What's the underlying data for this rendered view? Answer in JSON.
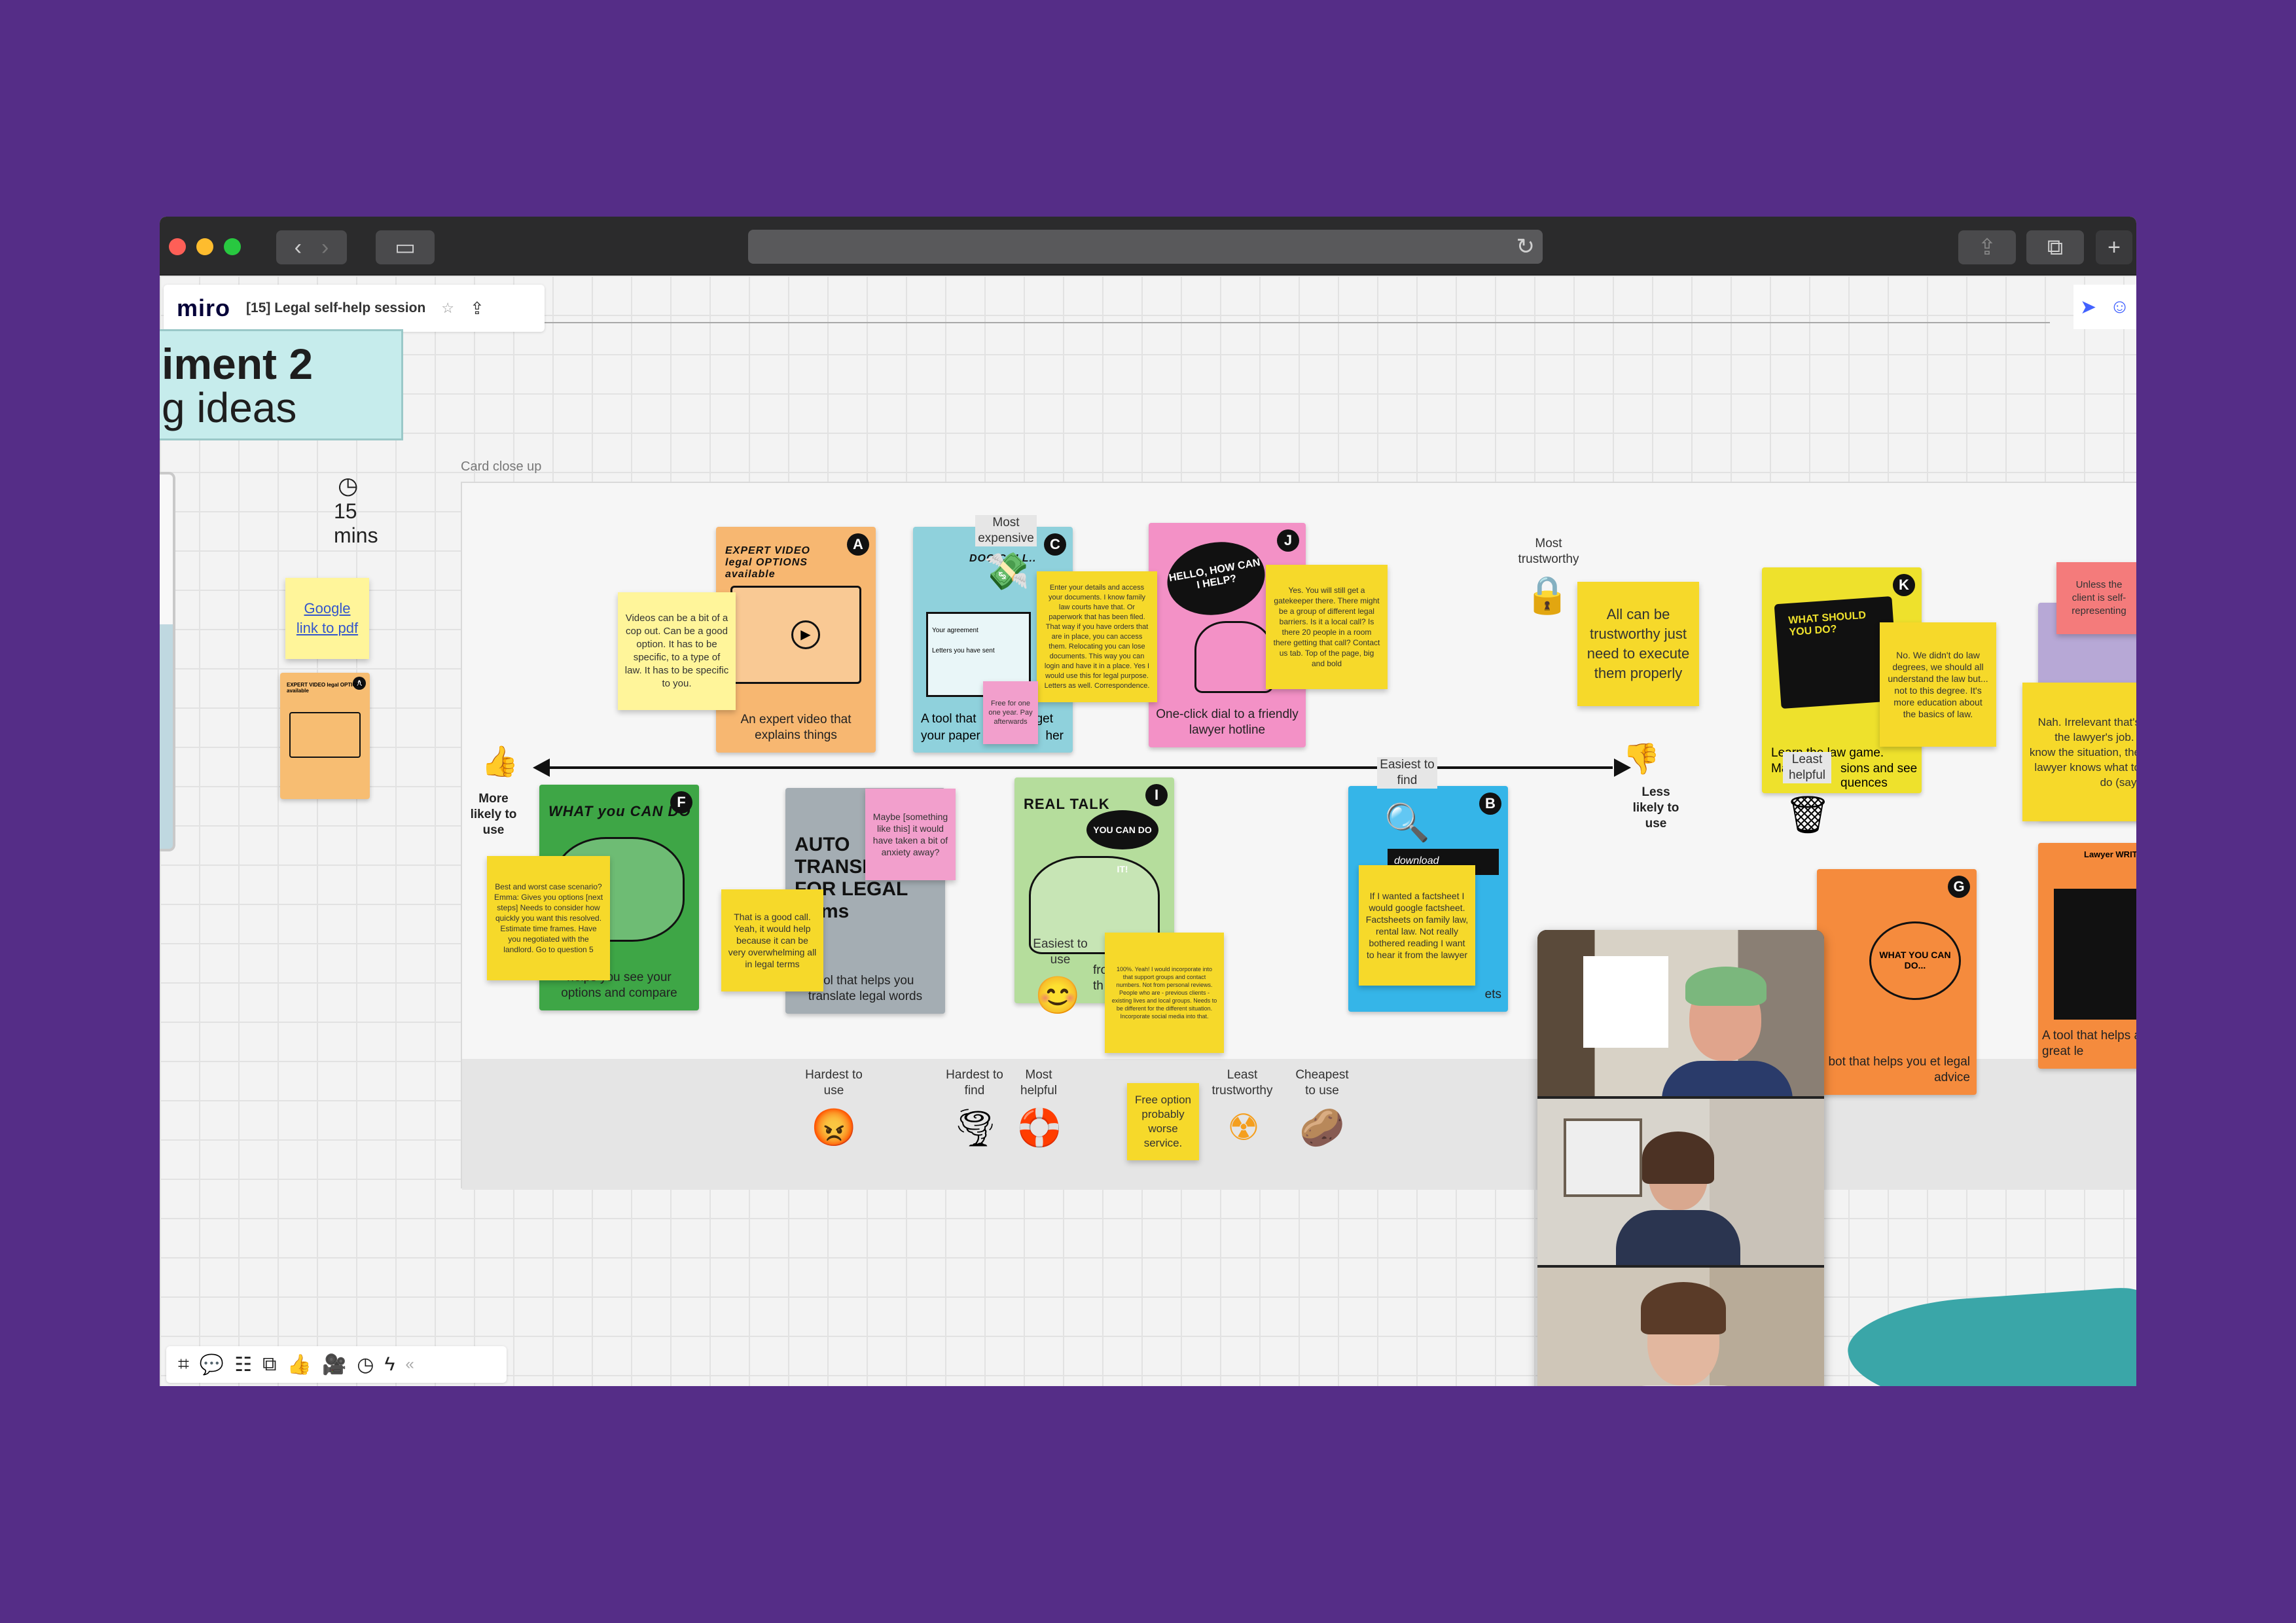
{
  "browser": {
    "toolbar_icons": [
      "back-icon",
      "forward-icon",
      "sidebar-icon",
      "share-icon",
      "tabs-icon",
      "new-tab-icon"
    ]
  },
  "app": {
    "logo": "miro",
    "board_title": "[15] Legal self-help session",
    "star": "☆",
    "upload": "⇪"
  },
  "title_card": {
    "line1": "iment 2",
    "line2": "g ideas"
  },
  "timer": {
    "value": "15",
    "unit": "mins"
  },
  "link_note": "Google link to pdf",
  "frame": {
    "label": "Card close up"
  },
  "cards": {
    "A": {
      "letter": "A",
      "heading": "EXPERT VIDEO legal OPTIONS available",
      "caption": "An expert video that explains things"
    },
    "C": {
      "letter": "C",
      "heading": "DOC COLL..",
      "caption_left": "A tool that",
      "caption_mid": "your paper",
      "caption_right1": "get",
      "caption_right2": "her",
      "field1": "Your agreement",
      "field2": "Letters you have sent"
    },
    "J": {
      "letter": "J",
      "heading": "HELLO, HOW CAN I HELP?",
      "caption": "One-click dial to a friendly lawyer hotline"
    },
    "K": {
      "letter": "K",
      "heading": "WHAT SHOULD YOU DO?",
      "caption_a": "Learn the law game.",
      "caption_b": "Make",
      "caption_c": "sions and see",
      "caption_d": "quences"
    },
    "F": {
      "letter": "F",
      "heading": "WHAT you CAN DO",
      "caption": "helps you see your options and compare"
    },
    "AUTO": {
      "heading": "AUTO TRANSLATOR FOR LEGAL forms",
      "caption": "ool that helps you translate legal words"
    },
    "I": {
      "letter": "I",
      "heading": "REAL TALK",
      "bubble": "YOU CAN DO IT!",
      "caption": "from pe been th"
    },
    "B": {
      "letter": "B",
      "heading": "download",
      "caption": "ets"
    },
    "G": {
      "letter": "G",
      "heading": "WHAT YOU CAN DO...",
      "caption": "bot that helps you et legal advice"
    },
    "R": {
      "heading": "Lawyer WRITER",
      "caption": "A tool that helps a great le"
    }
  },
  "notes": {
    "video": "Videos can be a bit of a cop out. Can be a good option. It has to be specific, to a type of law. It has to be specific to you.",
    "docs": "Enter your details and access your documents. I know family law courts have that. Or paperwork that has been filed. That way if you have orders that are in place, you can access them. Relocating you can lose documents. This way you can login and have it in a place. Yes I would use this for legal purpose. Letters as well. Correspondence.",
    "free": "Free for one one year. Pay afterwards",
    "hotline": "Yes. You will still get a gatekeeper there. There might be a group of different legal barriers. Is it a local call? Is there 20 people in a room there getting that call? Contact us tab. Top of the page, big and bold",
    "trust": "All can be trustworthy just need to execute them properly",
    "law_degree": "No. We didn't do law degrees, we should all understand the law but... not to this degree. It's more education about the basics of law.",
    "self_rep": "Unless the client is self-representing",
    "irrelevant": "Nah. Irrelevant that's the lawyer's job. I know the situation, the lawyer knows what to do (say)",
    "best_worst": "Best and worst case scenario? Emma: Gives you options [next steps] Needs to consider how quickly you want this resolved. Estimate time frames. Have you negotiated with the landlord. Go to question 5",
    "good_call": "That is a good call. Yeah, it would help because it can be very overwhelming all in legal terms",
    "maybe": "Maybe [something like this] it would have taken a bit of anxiety away?",
    "realtalk": "100%. Yeah! I would incorporate into that support groups and contact numbers. Not from personal reviews. People who are - previous clients - existing lives and local groups. Needs to be different for the different situation. Incorporate social media into that.",
    "factsheet": "If I wanted a factsheet I would google factsheet. Factsheets on family law, rental law. Not really bothered reading I want to hear it from the lawyer",
    "free_option": "Free option probably worse service."
  },
  "labels": {
    "most_expensive": "Most expensive",
    "most_trustworthy": "Most trustworthy",
    "easiest_find": "Easiest to find",
    "least_helpful": "Least helpful",
    "easiest_use": "Easiest to use",
    "more_likely": "More likely to use",
    "less_likely": "Less likely to use",
    "hardest_use": "Hardest to use",
    "hardest_find": "Hardest to find",
    "most_helpful": "Most helpful",
    "least_trustworthy": "Least trustworthy",
    "cheapest": "Cheapest to use"
  },
  "emojis": {
    "money": "💸",
    "lock": "🔒",
    "magnifier": "🔍",
    "trash": "🗑",
    "smile": "😊",
    "thumbs_up": "👍",
    "thumbs_down": "👎",
    "angry": "😡",
    "tornado": "🌪",
    "lifebuoy": "🛟",
    "radioactive": "☢",
    "potato": "🥔"
  },
  "bottom_toolbar": [
    "frame-icon",
    "comment-icon",
    "apps-icon",
    "share-screen-icon",
    "like-icon",
    "video-icon",
    "timer-icon",
    "bolt-icon",
    "collapse-icon"
  ],
  "colors": {
    "background": "#552d87",
    "accent": "#4262ff"
  }
}
